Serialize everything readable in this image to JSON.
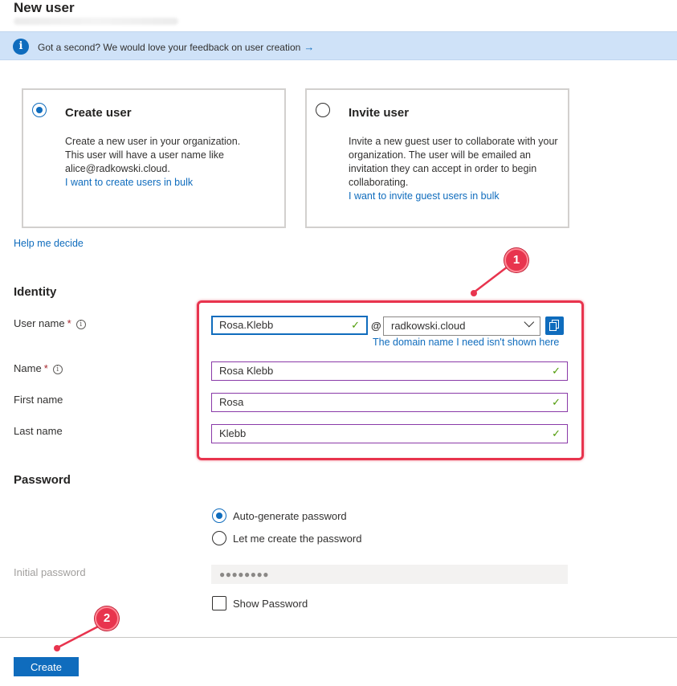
{
  "page": {
    "title": "New user"
  },
  "banner": {
    "text": "Got a second? We would love your feedback on user creation",
    "arrow": "→",
    "icon": "info-icon"
  },
  "options": {
    "create": {
      "title": "Create user",
      "description": "Create a new user in your organization. This user will have a user name like alice@radkowski.cloud.",
      "link": "I want to create users in bulk",
      "selected": true
    },
    "invite": {
      "title": "Invite user",
      "description": "Invite a new guest user to collaborate with your organization. The user will be emailed an invitation they can accept in order to begin collaborating.",
      "link": "I want to invite guest users in bulk",
      "selected": false
    },
    "help_link": "Help me decide"
  },
  "identity": {
    "section_title": "Identity",
    "username": {
      "label": "User name",
      "required": "*",
      "value": "Rosa.Klebb",
      "at": "@",
      "domain": "radkowski.cloud",
      "domain_link": "The domain name I need isn't shown here"
    },
    "name": {
      "label": "Name",
      "required": "*",
      "value": "Rosa Klebb"
    },
    "first_name": {
      "label": "First name",
      "value": "Rosa"
    },
    "last_name": {
      "label": "Last name",
      "value": "Klebb"
    },
    "valid_mark": "✓",
    "info_mark": "i"
  },
  "password": {
    "section_title": "Password",
    "auto_label": "Auto-generate password",
    "manual_label": "Let me create the password",
    "selected": "auto",
    "initial_label": "Initial password",
    "masked_value": "●●●●●●●●",
    "show_label": "Show Password"
  },
  "footer": {
    "create_label": "Create"
  },
  "annotations": {
    "marker1": "1",
    "marker2": "2",
    "color": "#e8344e"
  }
}
